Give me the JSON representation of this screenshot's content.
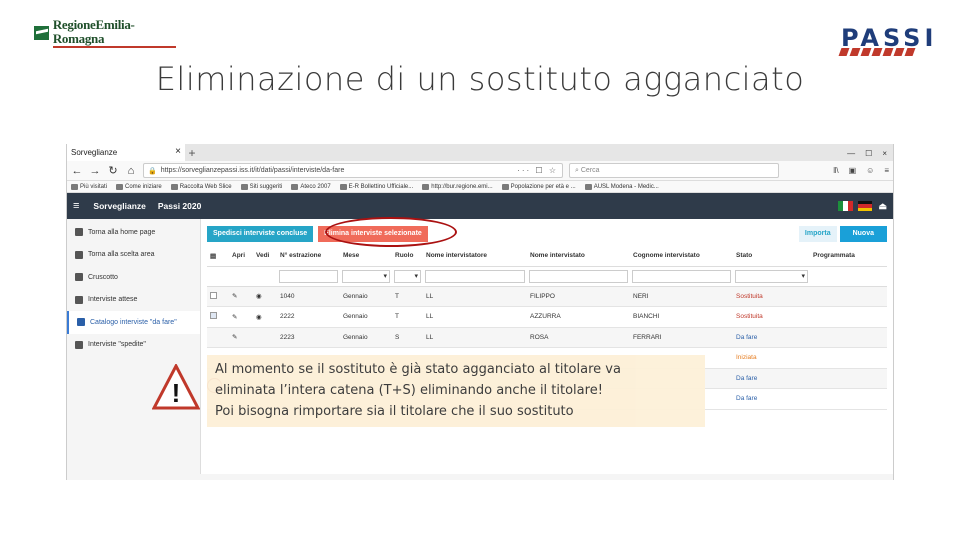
{
  "slide": {
    "region_logo_text": "RegioneEmilia-Romagna",
    "title": "Eliminazione di un sostituto agganciato",
    "passi_logo_text": "PASSI",
    "note_lines": [
      "Al momento se il sostituto è già stato agganciato al titolare va",
      "eliminata l’intera catena (T+S) eliminando anche il titolare!",
      "Poi bisogna rimportare sia il titolare che il suo sostituto"
    ],
    "warning_symbol": "!"
  },
  "browser": {
    "tab_title": "Sorveglianze",
    "tab_close": "×",
    "new_tab": "+",
    "url": "https://sorveglianzepassi.iss.it/it/dati/passi/interviste/da-fare",
    "url_actions": "··· ☐ ☆",
    "search_placeholder": "Cerca",
    "window_controls": [
      "—",
      "☐",
      "×"
    ],
    "nav_icons": [
      "‖\\",
      "▣",
      "☺",
      "≡"
    ],
    "bookmarks": [
      "Più visitati",
      "Come iniziare",
      "Raccolta Web Slice",
      "Siti suggeriti",
      "Ateco 2007",
      "E-R Bollettino Ufficiale...",
      "http://bur.regione.emi...",
      "Popolazione per età e ...",
      "AUSL Modena - Medic..."
    ]
  },
  "app": {
    "menu_icon": "≡",
    "name": "Sorveglianze",
    "section": "Passi 2020",
    "logout_icon": "⏏",
    "colors": {
      "appbar": "#2f3b4a",
      "teal": "#26a5c7",
      "red": "#f06b5a",
      "blue": "#1aa0d8"
    }
  },
  "sidebar": {
    "items": [
      {
        "label": "Torna alla home page",
        "icon": "home-icon"
      },
      {
        "label": "Torna alla scelta area",
        "icon": "play-icon"
      },
      {
        "label": "Cruscotto",
        "icon": "dashboard-icon"
      },
      {
        "label": "Interviste attese",
        "icon": "list-icon"
      },
      {
        "label": "Catalogo interviste \"da fare\"",
        "icon": "clipboard-icon",
        "active": true
      },
      {
        "label": "Interviste \"spedite\"",
        "icon": "check-icon"
      }
    ]
  },
  "toolbar": {
    "send_label": "Spedisci interviste concluse",
    "delete_label": "Elimina interviste selezionate",
    "import_label": "Importa",
    "new_label": "Nuova"
  },
  "table": {
    "headers": [
      "",
      "Apri",
      "Vedi",
      "N° estrazione",
      "Mese",
      "Ruolo",
      "Nome intervistatore",
      "Nome intervistato",
      "Cognome intervistato",
      "Stato",
      "Programmata"
    ],
    "rows": [
      {
        "n": "1040",
        "mese": "Gennaio",
        "ruolo": "T",
        "intervistatore": "LL",
        "nome": "FILIPPO",
        "cognome": "NERI",
        "stato": "Sostituita",
        "stato_class": "st-sost",
        "checked": false,
        "view": true
      },
      {
        "n": "2222",
        "mese": "Gennaio",
        "ruolo": "T",
        "intervistatore": "LL",
        "nome": "AZZURRA",
        "cognome": "BIANCHI",
        "stato": "Sostituita",
        "stato_class": "st-sost",
        "checked": true,
        "view": true
      },
      {
        "n": "2223",
        "mese": "Gennaio",
        "ruolo": "S",
        "intervistatore": "LL",
        "nome": "ROSA",
        "cognome": "FERRARI",
        "stato": "Da fare",
        "stato_class": "st-dafare",
        "checked": false,
        "view": false
      },
      {
        "n": "",
        "mese": "",
        "ruolo": "",
        "intervistatore": "",
        "nome": "",
        "cognome": "",
        "stato": "Iniziata",
        "stato_class": "st-iniz",
        "checked": false,
        "view": false
      },
      {
        "n": "",
        "mese": "",
        "ruolo": "",
        "intervistatore": "",
        "nome": "",
        "cognome": "",
        "stato": "Da fare",
        "stato_class": "st-dafare",
        "checked": false,
        "view": false
      },
      {
        "n": "",
        "mese": "",
        "ruolo": "",
        "intervistatore": "",
        "nome": "",
        "cognome": "",
        "stato": "Da fare",
        "stato_class": "st-dafare",
        "checked": false,
        "view": false
      }
    ]
  }
}
